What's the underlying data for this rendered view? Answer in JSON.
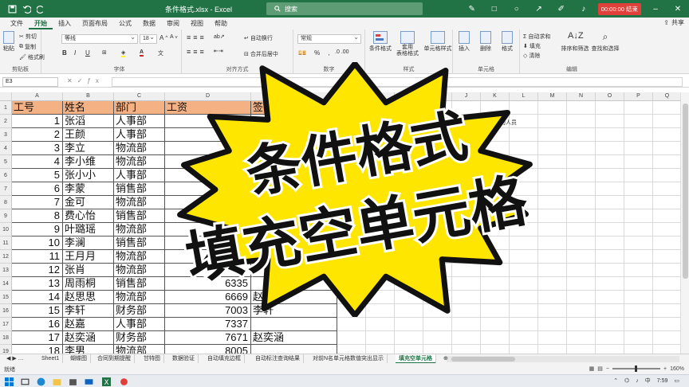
{
  "window": {
    "title": "条件格式.xlsx - Excel",
    "search_placeholder": "搜索",
    "record_time": "00:00:00 结束"
  },
  "ribbon_tabs": [
    "文件",
    "开始",
    "插入",
    "页面布局",
    "公式",
    "数据",
    "审阅",
    "视图",
    "帮助"
  ],
  "share_label": "共享",
  "ribbon": {
    "clipboard": {
      "label": "剪贴板",
      "paste": "粘贴",
      "cut": "剪切",
      "copy": "复制",
      "format_painter": "格式刷"
    },
    "font": {
      "label": "字体",
      "name": "等线",
      "size": "18"
    },
    "alignment": {
      "label": "对齐方式",
      "wrap": "自动换行",
      "merge": "合并后居中"
    },
    "number": {
      "label": "数字",
      "format": "常规"
    },
    "styles": {
      "label": "样式",
      "conditional": "条件格式",
      "table": "套用\n表格格式",
      "cell_styles": "单元格样式"
    },
    "cells": {
      "label": "单元格",
      "insert": "插入",
      "delete": "删除",
      "format": "格式"
    },
    "editing": {
      "label": "编辑",
      "autosum": "自动求和",
      "fill": "填充",
      "clear": "清除",
      "sort": "排序和筛选",
      "find": "查找和选择"
    }
  },
  "name_box": "E3",
  "columns": [
    "A",
    "B",
    "C",
    "D",
    "E",
    "F",
    "G",
    "H",
    "I",
    "J",
    "K",
    "L",
    "M",
    "N",
    "O",
    "P",
    "Q"
  ],
  "header_row": {
    "a": "工号",
    "b": "姓名",
    "c": "部门",
    "d": "工资",
    "e": "签名"
  },
  "rows": [
    {
      "n": "2",
      "a": "1",
      "b": "张滔",
      "c": "人事部",
      "d": "",
      "e": ""
    },
    {
      "n": "3",
      "a": "2",
      "b": "王颜",
      "c": "人事部",
      "d": "",
      "e": ""
    },
    {
      "n": "4",
      "a": "3",
      "b": "李立",
      "c": "物流部",
      "d": "",
      "e": ""
    },
    {
      "n": "5",
      "a": "4",
      "b": "李小维",
      "c": "物流部",
      "d": "",
      "e": ""
    },
    {
      "n": "6",
      "a": "5",
      "b": "张小小",
      "c": "人事部",
      "d": "",
      "e": ""
    },
    {
      "n": "7",
      "a": "6",
      "b": "李蒙",
      "c": "销售部",
      "d": "",
      "e": ""
    },
    {
      "n": "8",
      "a": "7",
      "b": "金可",
      "c": "物流部",
      "d": "",
      "e": ""
    },
    {
      "n": "9",
      "a": "8",
      "b": "费心怡",
      "c": "销售部",
      "d": "",
      "e": ""
    },
    {
      "n": "10",
      "a": "9",
      "b": "叶璐瑶",
      "c": "物流部",
      "d": "",
      "e": ""
    },
    {
      "n": "11",
      "a": "10",
      "b": "李澜",
      "c": "销售部",
      "d": "",
      "e": ""
    },
    {
      "n": "12",
      "a": "11",
      "b": "王月月",
      "c": "物流部",
      "d": "",
      "e": ""
    },
    {
      "n": "13",
      "a": "12",
      "b": "张肖",
      "c": "物流部",
      "d": "",
      "e": ""
    },
    {
      "n": "14",
      "a": "13",
      "b": "周雨桐",
      "c": "销售部",
      "d": "6335",
      "e": ""
    },
    {
      "n": "15",
      "a": "14",
      "b": "赵思思",
      "c": "物流部",
      "d": "6669",
      "e": "赵思思"
    },
    {
      "n": "16",
      "a": "15",
      "b": "李轩",
      "c": "财务部",
      "d": "7003",
      "e": "李轩"
    },
    {
      "n": "17",
      "a": "16",
      "b": "赵嘉",
      "c": "人事部",
      "d": "7337",
      "e": ""
    },
    {
      "n": "18",
      "a": "17",
      "b": "赵奕涵",
      "c": "财务部",
      "d": "7671",
      "e": "赵奕涵"
    },
    {
      "n": "19",
      "a": "18",
      "b": "李男",
      "c": "物流部",
      "d": "8005",
      "e": ""
    }
  ],
  "note_text": "提示未发放工资的人员",
  "overlay": {
    "line1": "条件格式",
    "line2": "填充空单元格",
    "colors": {
      "burst": "#ffe600",
      "outline": "#111111"
    }
  },
  "sheet_tabs": [
    "Sheet1",
    "蝴蝶图",
    "合同到期提醒",
    "甘特图",
    "数据验证",
    "自动填充边框",
    "自动标注查询结果",
    "对前N名单元格数值突出显示",
    "填充空单元格"
  ],
  "active_sheet": "填充空单元格",
  "status": {
    "ready": "就绪",
    "zoom": "160%"
  },
  "taskbar": {
    "time": "7:59",
    "lang": "中"
  },
  "accent": "#217346"
}
